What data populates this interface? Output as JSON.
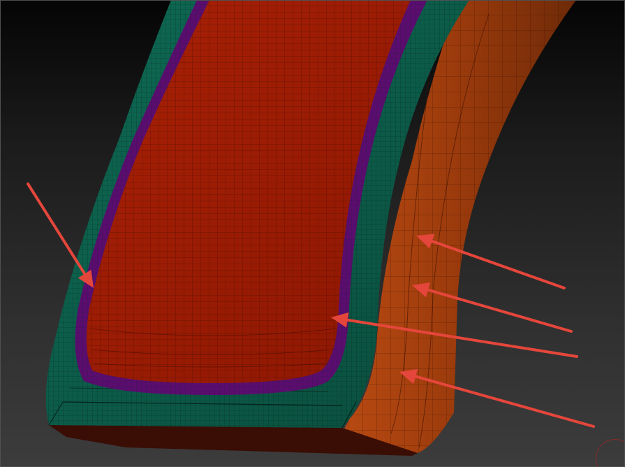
{
  "app": {
    "view": "3D viewport"
  },
  "colors": {
    "background_top": "#050505",
    "background_bottom": "#3c3c3c",
    "teal_bevel": "#0c5a47",
    "purple_layer": "#5a0d6e",
    "red_face": "#9e1c04",
    "orange_side": "#a8400d",
    "annotation_arrow": "#e5463b",
    "wire": "#1a0500"
  },
  "annotations": {
    "arrow_count": 5,
    "arrows": [
      {
        "name": "arrow-left-pointing-purple-border"
      },
      {
        "name": "arrow-right-pointing-orange-side-upper"
      },
      {
        "name": "arrow-right-pointing-orange-side-middle"
      },
      {
        "name": "arrow-right-pointing-purple-inner-corner"
      },
      {
        "name": "arrow-right-pointing-orange-side-lower"
      }
    ]
  },
  "mesh": {
    "shape": "curved bevelled band",
    "wireframe": true
  }
}
